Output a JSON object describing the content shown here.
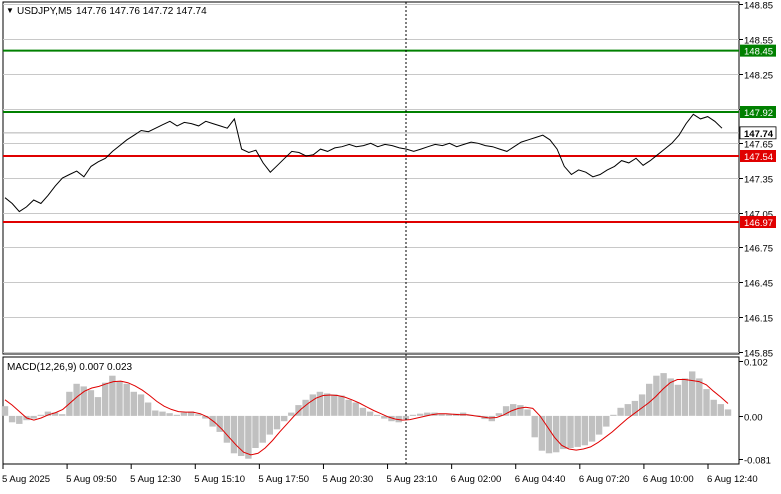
{
  "header": {
    "arrow": "▼",
    "symbol": "USDJPY,M5",
    "ohlc": "147.76 147.76 147.72 147.74"
  },
  "price_axis": {
    "ticks": [
      "148.85",
      "148.55",
      "148.25",
      "147.95",
      "147.65",
      "147.35",
      "147.05",
      "146.75",
      "146.45",
      "146.15",
      "145.85"
    ],
    "min": 145.83,
    "max": 148.87
  },
  "levels": [
    {
      "name": "resistance-high",
      "value": 148.45,
      "label": "148.45",
      "color": "#008000"
    },
    {
      "name": "resistance",
      "value": 147.92,
      "label": "147.92",
      "color": "#008000"
    },
    {
      "name": "support",
      "value": 147.54,
      "label": "147.54",
      "color": "#e00000"
    },
    {
      "name": "support-low",
      "value": 146.97,
      "label": "146.97",
      "color": "#e00000"
    }
  ],
  "current_price": {
    "value": 147.74,
    "label": "147.74"
  },
  "macd": {
    "label": "MACD(12,26,9) 0.007 0.023",
    "ticks": [
      "0.102",
      "0.00",
      "-0.081"
    ],
    "min": -0.09,
    "max": 0.11
  },
  "time_axis": {
    "labels": [
      "5 Aug 2025",
      "5 Aug 09:50",
      "5 Aug 12:30",
      "5 Aug 15:10",
      "5 Aug 17:50",
      "5 Aug 20:30",
      "5 Aug 23:10",
      "6 Aug 02:00",
      "6 Aug 04:40",
      "6 Aug 07:20",
      "6 Aug 10:00",
      "6 Aug 12:40"
    ]
  },
  "chart_data": {
    "type": "line",
    "title": "USDJPY,M5",
    "x_labels": [
      "5 Aug 2025",
      "5 Aug 09:50",
      "5 Aug 12:30",
      "5 Aug 15:10",
      "5 Aug 17:50",
      "5 Aug 20:30",
      "5 Aug 23:10",
      "6 Aug 02:00",
      "6 Aug 04:40",
      "6 Aug 07:20",
      "6 Aug 10:00",
      "6 Aug 12:40"
    ],
    "ylim": [
      145.83,
      148.87
    ],
    "series": [
      {
        "values": [
          147.18,
          147.13,
          147.06,
          147.1,
          147.16,
          147.13,
          147.2,
          147.28,
          147.35,
          147.38,
          147.41,
          147.36,
          147.45,
          147.49,
          147.52,
          147.58,
          147.63,
          147.68,
          147.72,
          147.76,
          147.75,
          147.78,
          147.81,
          147.84,
          147.8,
          147.83,
          147.82,
          147.8,
          147.84,
          147.82,
          147.8,
          147.78,
          147.86,
          147.6,
          147.57,
          147.59,
          147.48,
          147.4,
          147.46,
          147.52,
          147.58,
          147.57,
          147.54,
          147.55,
          147.6,
          147.58,
          147.61,
          147.62,
          147.64,
          147.62,
          147.63,
          147.65,
          147.62,
          147.64,
          147.63,
          147.61,
          147.6,
          147.58,
          147.6,
          147.62,
          147.64,
          147.63,
          147.65,
          147.62,
          147.64,
          147.66,
          147.65,
          147.63,
          147.62,
          147.6,
          147.58,
          147.62,
          147.66,
          147.68,
          147.7,
          147.72,
          147.68,
          147.6,
          147.45,
          147.38,
          147.42,
          147.4,
          147.36,
          147.38,
          147.42,
          147.45,
          147.5,
          147.48,
          147.52,
          147.46,
          147.5,
          147.55,
          147.6,
          147.65,
          147.72,
          147.82,
          147.9,
          147.86,
          147.88,
          147.84,
          147.78
        ]
      }
    ],
    "macd": {
      "histogram": [
        0.018,
        -0.012,
        -0.015,
        -0.008,
        -0.005,
        0.002,
        0.008,
        0.006,
        0.003,
        0.045,
        0.06,
        0.055,
        0.048,
        0.035,
        0.062,
        0.075,
        0.065,
        0.06,
        0.045,
        0.04,
        0.025,
        0.01,
        0.008,
        0.005,
        0.002,
        0.006,
        0.008,
        0.003,
        -0.005,
        -0.02,
        -0.03,
        -0.05,
        -0.07,
        -0.075,
        -0.08,
        -0.06,
        -0.05,
        -0.035,
        -0.025,
        -0.01,
        0.006,
        0.02,
        0.03,
        0.04,
        0.045,
        0.042,
        0.04,
        0.038,
        0.03,
        0.025,
        0.015,
        0.008,
        0.002,
        -0.005,
        -0.01,
        -0.012,
        -0.006,
        0.002,
        0.004,
        0.006,
        0.006,
        0.004,
        0.003,
        0.004,
        0.006,
        0.002,
        0.001,
        -0.006,
        -0.01,
        0.005,
        0.018,
        0.022,
        0.02,
        0.012,
        -0.04,
        -0.065,
        -0.07,
        -0.068,
        -0.062,
        -0.06,
        -0.058,
        -0.055,
        -0.048,
        -0.035,
        -0.02,
        0.002,
        0.015,
        0.022,
        0.028,
        0.04,
        0.06,
        0.075,
        0.08,
        0.07,
        0.058,
        0.07,
        0.083,
        0.07,
        0.05,
        0.03,
        0.022,
        0.012
      ],
      "signal": [
        0.03,
        0.02,
        0.008,
        -0.004,
        -0.008,
        -0.004,
        0.002,
        0.006,
        0.012,
        0.024,
        0.036,
        0.046,
        0.052,
        0.055,
        0.06,
        0.064,
        0.065,
        0.062,
        0.056,
        0.048,
        0.038,
        0.027,
        0.018,
        0.012,
        0.008,
        0.007,
        0.007,
        0.004,
        -0.002,
        -0.012,
        -0.025,
        -0.04,
        -0.055,
        -0.068,
        -0.073,
        -0.07,
        -0.06,
        -0.046,
        -0.03,
        -0.015,
        0.0,
        0.013,
        0.024,
        0.033,
        0.038,
        0.039,
        0.038,
        0.035,
        0.03,
        0.024,
        0.017,
        0.01,
        0.004,
        -0.002,
        -0.006,
        -0.008,
        -0.007,
        -0.004,
        -0.001,
        0.002,
        0.004,
        0.004,
        0.003,
        0.002,
        0.002,
        0.0,
        -0.002,
        -0.004,
        -0.003,
        0.002,
        0.009,
        0.014,
        0.016,
        0.014,
        0.0,
        -0.02,
        -0.04,
        -0.055,
        -0.062,
        -0.064,
        -0.062,
        -0.058,
        -0.05,
        -0.04,
        -0.03,
        -0.018,
        -0.006,
        0.004,
        0.014,
        0.024,
        0.036,
        0.05,
        0.062,
        0.068,
        0.068,
        0.066,
        0.064,
        0.058,
        0.046,
        0.035,
        0.023
      ]
    }
  }
}
